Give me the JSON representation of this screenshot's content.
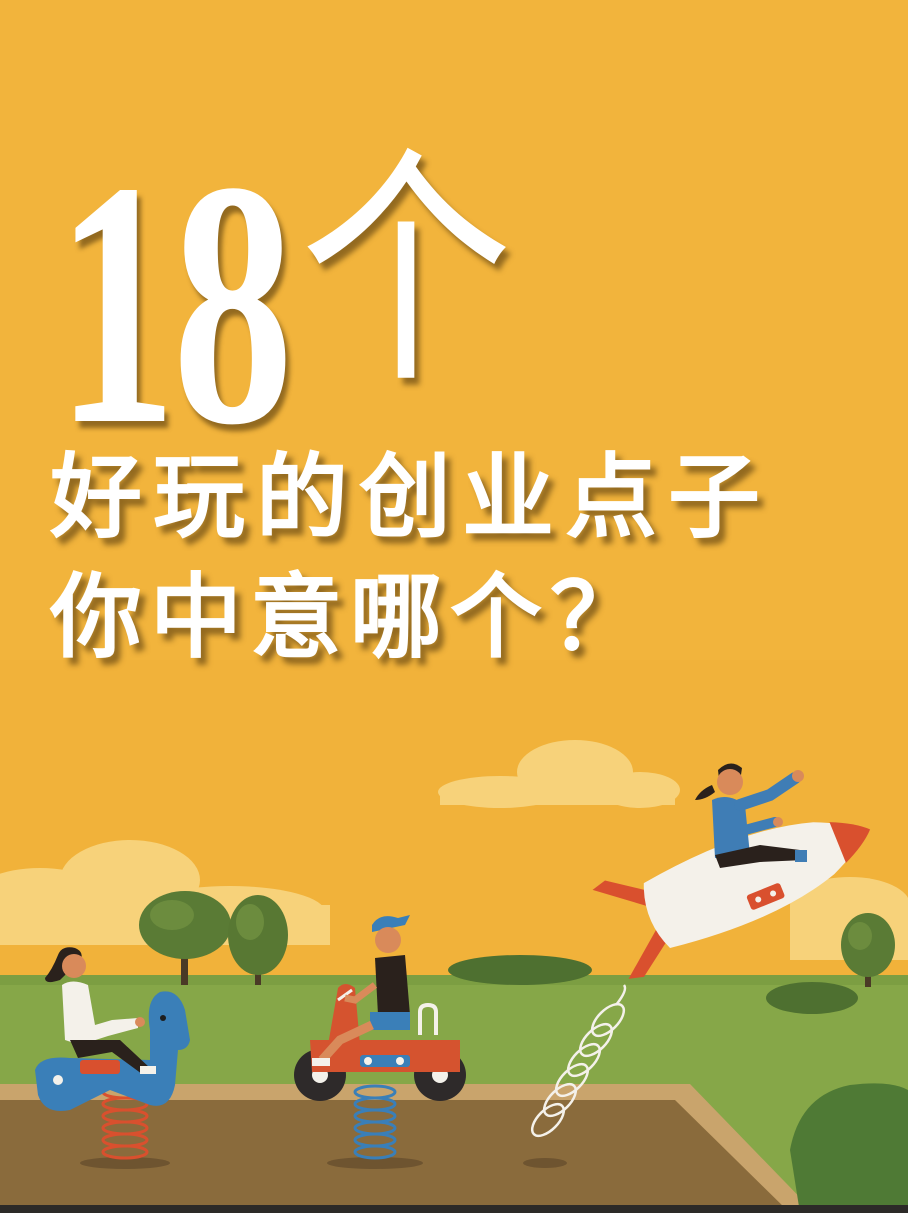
{
  "headline": {
    "number": "18",
    "unit": "个"
  },
  "subtitle": {
    "line1": "好玩的创业点子",
    "line2": "你中意哪个？"
  },
  "colors": {
    "sky": "#F2B43C",
    "cloud": "#F7D27A",
    "grass": "#86A748",
    "tree": "#5A7B35",
    "sand": "#8A6B3C",
    "sandbox_frame": "#C9A46C",
    "horse": "#3A7FB8",
    "motorbike": "#D5532F",
    "rocket": "#F4F1EA",
    "rocket_accent": "#D9502E",
    "title_text": "#FFFFFF"
  },
  "illustration": {
    "icons": [
      "cloud-icon",
      "tree-icon",
      "spring-rider-horse-icon",
      "spring-rider-motorbike-icon",
      "rocket-icon",
      "spring-icon"
    ]
  }
}
